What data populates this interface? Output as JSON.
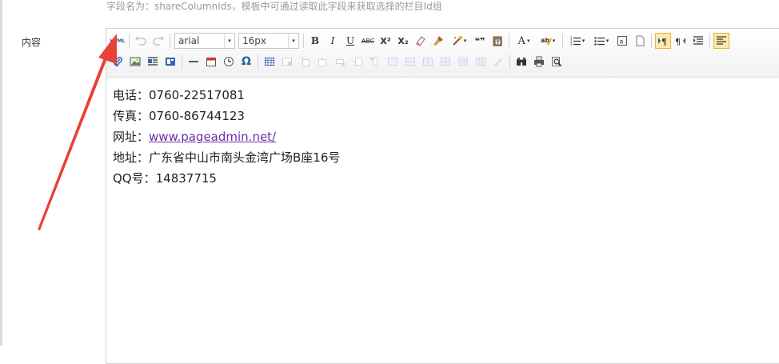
{
  "hint": {
    "text": "字段名为：shareColumnIds，模板中可通过读取此字段来获取选择的栏目Id组"
  },
  "field": {
    "label": "内容"
  },
  "toolbar": {
    "html_label": "HTML",
    "font_family": "arial",
    "font_size": "16px",
    "bold_label": "B",
    "italic_label": "I",
    "underline_label": "U",
    "strike_label": "ABC",
    "superscript_label": "X²",
    "subscript_label": "X₂",
    "blockquote_label": "❝❞",
    "forecolor_label": "A",
    "special_char_label": "Ω",
    "dropdown_arrow": "▾"
  },
  "content": {
    "lines": [
      {
        "label": "电话：",
        "value": "0760-22517081"
      },
      {
        "label": "传真：",
        "value": "0760-86744123"
      },
      {
        "label": "网址：",
        "value": "www.pageadmin.net/"
      },
      {
        "label": "地址：",
        "value": "广东省中山市南头金湾广场B座16号"
      },
      {
        "label": "QQ号：",
        "value": "14837715"
      }
    ]
  },
  "colors": {
    "annotation_arrow": "#e8413a",
    "link": "#6a2ea8",
    "active_button_bg": "#fde9a9"
  }
}
